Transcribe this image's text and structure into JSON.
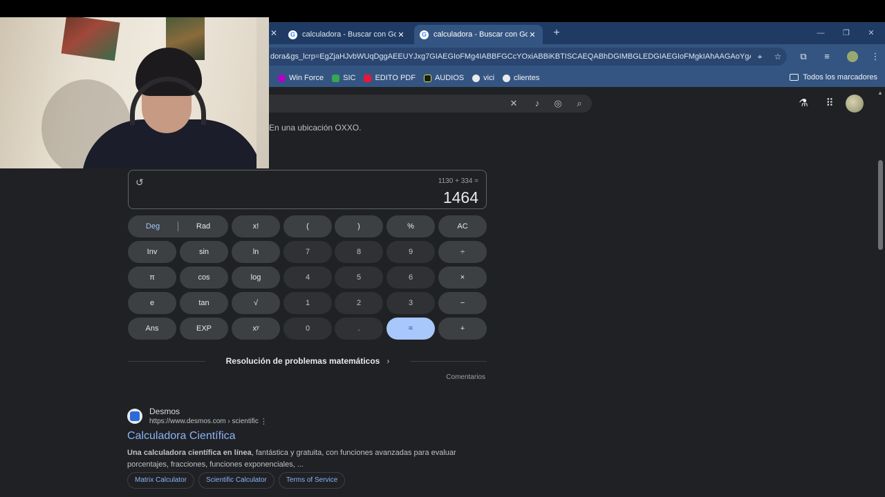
{
  "browser": {
    "tabs": [
      {
        "title": "calculadora - Buscar con Google",
        "close": "✕"
      },
      {
        "title": "calculadora - Buscar con Google",
        "close": "✕"
      }
    ],
    "left_close": "✕",
    "new_tab": "+",
    "window_controls": {
      "minimize": "—",
      "restore": "❐",
      "close": "✕"
    },
    "url": "dora&gs_lcrp=EgZjaHJvbWUqDggAEEUYJxg7GIAEGIoFMg4IABBFGCcYOxiABBiKBTISCAEQABhDGIMBGLEDGIAEGIoFMgkIAhAAGAoYgAQy...",
    "bookmarks": [
      {
        "label": "Win Force",
        "color": "#b100c8"
      },
      {
        "label": "SIC",
        "color": "#34a853"
      },
      {
        "label": "EDITO PDF",
        "color": "#e8173a"
      },
      {
        "label": "AUDIOS",
        "color": "#1a1a1a"
      },
      {
        "label": "vici",
        "color": "#e8eaed"
      },
      {
        "label": "clientes",
        "color": "#e8eaed"
      }
    ],
    "all_bookmarks": "Todos los marcadores"
  },
  "page": {
    "location_snippet": "En una ubicación OXXO.",
    "calculator": {
      "expression": "1130 + 334 =",
      "result": "1464",
      "deg": "Deg",
      "rad": "Rad",
      "keys": {
        "xfact": "x!",
        "lparen": "(",
        "rparen": ")",
        "percent": "%",
        "ac": "AC",
        "inv": "Inv",
        "sin": "sin",
        "ln": "ln",
        "k7": "7",
        "k8": "8",
        "k9": "9",
        "divide": "÷",
        "pi": "π",
        "cos": "cos",
        "log": "log",
        "k4": "4",
        "k5": "5",
        "k6": "6",
        "multiply": "×",
        "e": "e",
        "tan": "tan",
        "sqrt": "√",
        "k1": "1",
        "k2": "2",
        "k3": "3",
        "minus": "−",
        "ans": "Ans",
        "exp": "EXP",
        "xpow": "xʸ",
        "k0": "0",
        "dot": ".",
        "equals": "=",
        "plus": "+"
      },
      "solve_label": "Resolución de problemas matemáticos",
      "feedback": "Comentarios"
    },
    "result": {
      "site": "Desmos",
      "url": "https://www.desmos.com › scientific",
      "title": "Calculadora Científica",
      "desc_bold": "Una calculadora científica en línea",
      "desc_rest": ", fantástica y gratuita, con funciones avanzadas para evaluar porcentajes, fracciones, funciones exponenciales, ...",
      "chips": [
        "Matrix Calculator",
        "Scientific Calculator",
        "Terms of Service"
      ]
    }
  },
  "colors": {
    "accent": "#a8c7fa",
    "link": "#8ab4f8",
    "tabbar": "#1f3b63",
    "toolbar": "#345581",
    "page_bg": "#202124"
  }
}
